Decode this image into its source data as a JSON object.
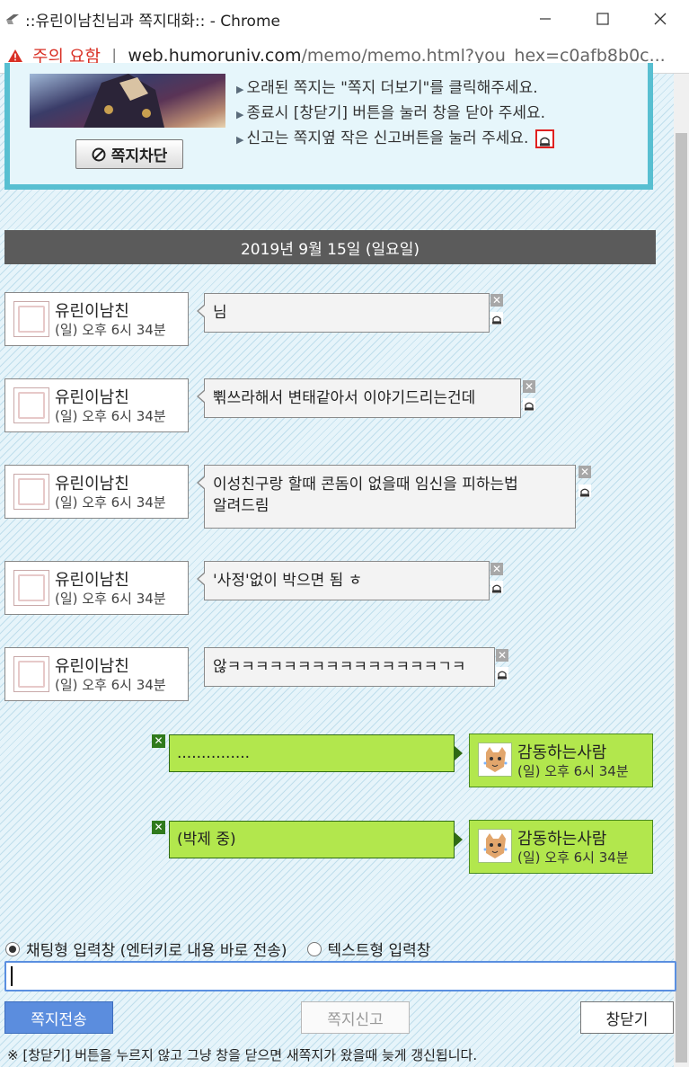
{
  "window": {
    "title": "::유린이남친님과 쪽지대화:: - Chrome",
    "minimize_glyph": "—",
    "maximize_glyph": "☐",
    "close_glyph": "✕"
  },
  "address_bar": {
    "security_label": "주의 요함",
    "separator": "|",
    "host": "web.humoruniv.com",
    "path": "/memo/memo.html?you_hex=c0afb8b0c..."
  },
  "notice": {
    "block_button_label": "쪽지차단",
    "lines": [
      "오래된 쪽지는 \"쪽지 더보기\"를 클릭해주세요.",
      "종료시 [창닫기] 버튼을 눌러 창을 닫아 주세요.",
      "신고는 쪽지옆 작은 신고버튼을 눌러 주세요."
    ]
  },
  "date_header": "2019년 9월 15일 (일요일)",
  "messages": [
    {
      "nick": "유린이남친",
      "time": "(일) 오후 6시 34분",
      "text": "님"
    },
    {
      "nick": "유린이남친",
      "time": "(일) 오후 6시 34분",
      "text": "쀢쓰라해서 변태같아서 이야기드리는건데"
    },
    {
      "nick": "유린이남친",
      "time": "(일) 오후 6시 34분",
      "text_lines": [
        "이성친구랑 할때 콘돔이 없을때 임신을 피하는법",
        "알려드림"
      ]
    },
    {
      "nick": "유린이남친",
      "time": "(일) 오후 6시 34분",
      "text": "'사정'없이 박으면 됨 ㅎ"
    },
    {
      "nick": "유린이남친",
      "time": "(일) 오후 6시 34분",
      "text": "않ㅋㅋㅋㅋㅋㅋㅋㅋㅋㅋㅋㅋㅋㅋㅋㄱㅋ"
    }
  ],
  "my_messages": [
    {
      "nick": "감동하는사람",
      "time": "(일) 오후 6시 34분",
      "text": "..............."
    },
    {
      "nick": "감동하는사람",
      "time": "(일) 오후 6시 34분",
      "text": "(박제 중)"
    }
  ],
  "input_area": {
    "radio_chat_label": "채팅형 입력창 (엔터키로 내용 바로 전송)",
    "radio_text_label": "텍스트형 입력창",
    "input_value": "",
    "send_button": "쪽지전송",
    "report_button": "쪽지신고",
    "close_button": "창닫기",
    "footnote": "※ [창닫기] 버튼을 누르지 않고 그냥 창을 닫으면 새쪽지가 왔을때 늦게 갱신됩니다."
  },
  "colors": {
    "date_bar": "#5b5b5b",
    "my_bubble": "#b2e74d",
    "notice_border": "#58bfd1",
    "send_button": "#5b8dde",
    "warning": "#d93025"
  },
  "icons": [
    "app-icon",
    "minimize-icon",
    "maximize-icon",
    "close-icon",
    "warning-icon",
    "block-icon",
    "report-icon",
    "delete-icon",
    "avatar-icon"
  ]
}
